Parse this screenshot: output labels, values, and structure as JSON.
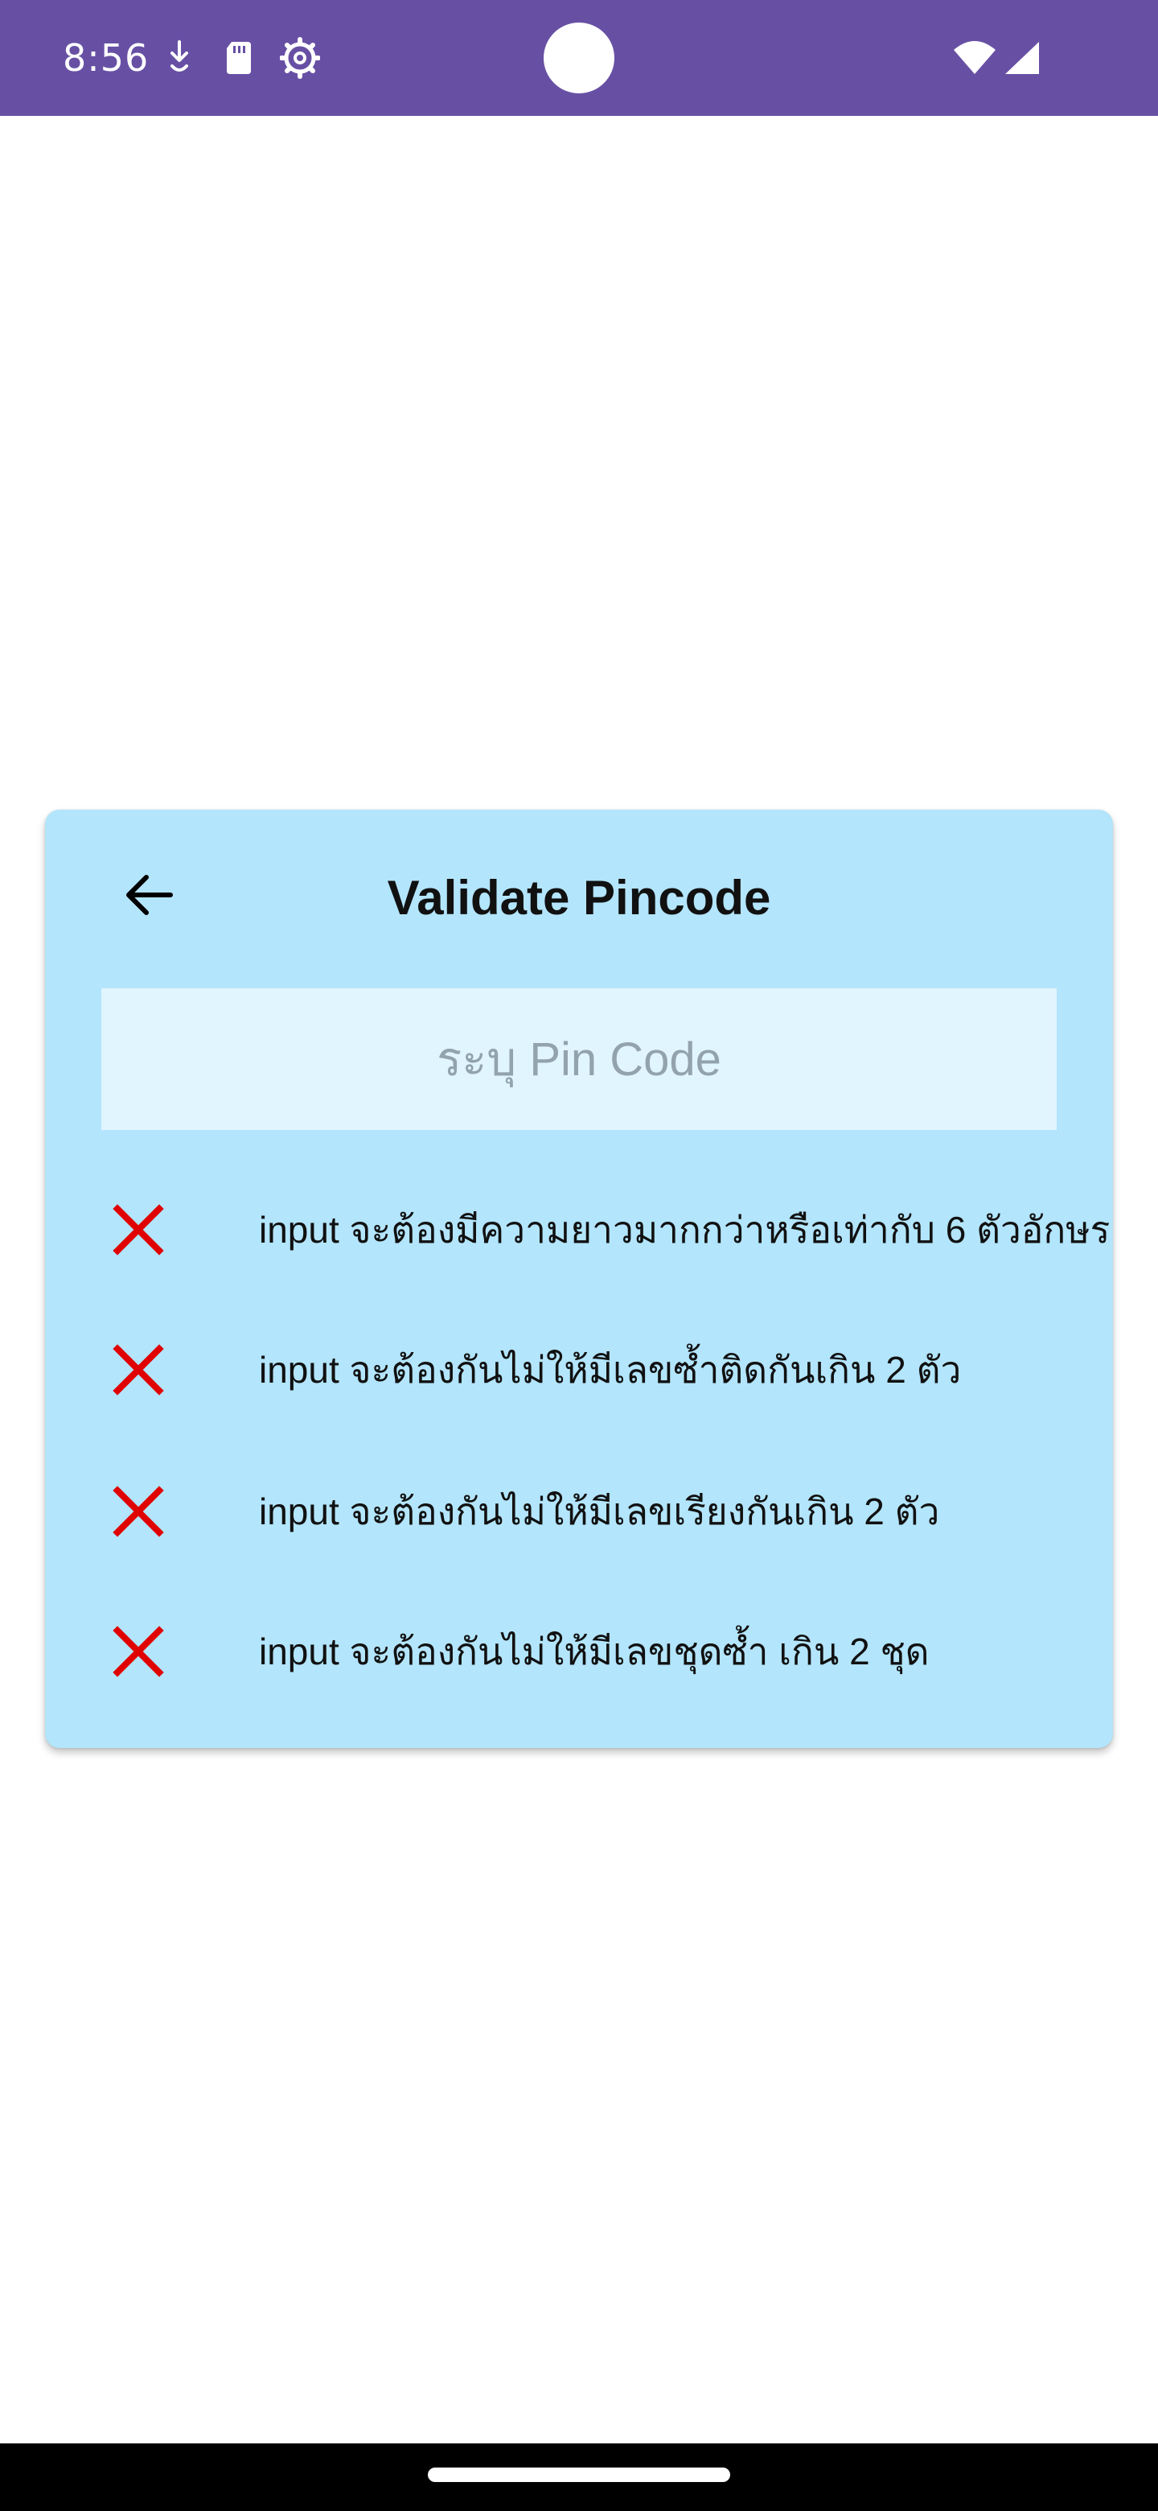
{
  "status_bar": {
    "time": "8:56",
    "background_color": "#6750a4",
    "icons": [
      "download-arrow-icon",
      "sd-card-icon",
      "settings-gear-icon",
      "wifi-icon",
      "cellular-signal-icon"
    ]
  },
  "card": {
    "background_color": "#b3e5fc",
    "title": "Validate Pincode",
    "back_icon": "arrow-back-icon",
    "pin_input": {
      "placeholder": "ระบุ Pin Code",
      "value": ""
    },
    "rules": [
      {
        "status": "failed",
        "icon": "red-cross-icon",
        "text": "input จะต้องมีความยาวมากกว่าหรือเท่ากับ 6 ตัวอักษร"
      },
      {
        "status": "failed",
        "icon": "red-cross-icon",
        "text": "input จะต้องกันไม่ให้มีเลขซ้ำติดกันเกิน 2 ตัว"
      },
      {
        "status": "failed",
        "icon": "red-cross-icon",
        "text": "input จะต้องกันไม่ให้มีเลขเรียงกันเกิน 2 ตัว"
      },
      {
        "status": "failed",
        "icon": "red-cross-icon",
        "text": "input จะต้องกันไม่ให้มีเลขชุดซ้ำ เกิน 2 ชุด"
      }
    ],
    "fail_color": "#e00000"
  }
}
